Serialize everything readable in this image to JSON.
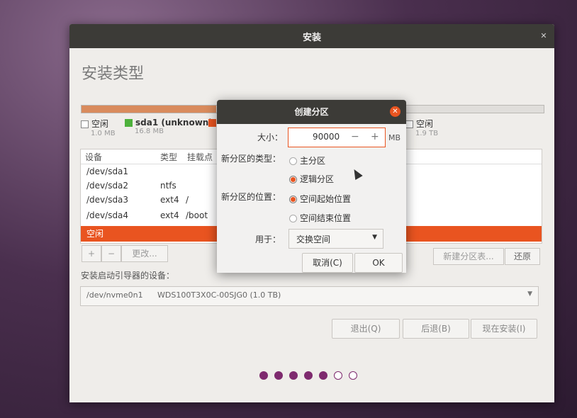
{
  "window": {
    "title": "安装"
  },
  "page": {
    "heading": "安装类型"
  },
  "partition_bar": {
    "legend": [
      {
        "name": "空闲",
        "size": "1.0 MB",
        "color": "#ffffff"
      },
      {
        "name": "sda1 (unknown)",
        "size": "16.8 MB",
        "color": "#4eb13c"
      },
      {
        "name": "",
        "size": "",
        "color": "#e95420"
      },
      {
        "name": "空闲",
        "size": "1.9 TB",
        "color": "#ffffff"
      }
    ]
  },
  "table": {
    "headers": [
      "设备",
      "类型",
      "挂载点"
    ],
    "rows": [
      {
        "device": "/dev/sda1",
        "type": "",
        "mount": ""
      },
      {
        "device": "/dev/sda2",
        "type": "ntfs",
        "mount": ""
      },
      {
        "device": "/dev/sda3",
        "type": "ext4",
        "mount": "/"
      },
      {
        "device": "/dev/sda4",
        "type": "ext4",
        "mount": "/boot"
      },
      {
        "device": "空闲",
        "type": "",
        "mount": ""
      }
    ]
  },
  "toolbar": {
    "add": "+",
    "remove": "−",
    "change": "更改...",
    "new_table": "新建分区表...",
    "revert": "还原"
  },
  "bootloader": {
    "label": "安装启动引导器的设备：",
    "device": "/dev/nvme0n1",
    "model": "WDS100T3X0C-00SJG0 (1.0 TB)"
  },
  "buttons": {
    "quit": "退出(Q)",
    "back": "后退(B)",
    "install": "现在安装(I)"
  },
  "progress": {
    "total_steps": 7,
    "completed_steps": 5
  },
  "dialog": {
    "title": "创建分区",
    "size_label": "大小：",
    "size_value": "90000",
    "minus": "−",
    "plus": "+",
    "unit": "MB",
    "type_label": "新分区的类型：",
    "type_options": [
      "主分区",
      "逻辑分区"
    ],
    "type_selected": "逻辑分区",
    "location_label": "新分区的位置：",
    "location_options": [
      "空间起始位置",
      "空间结束位置"
    ],
    "location_selected": "空间起始位置",
    "use_label": "用于：",
    "use_value": "交换空间",
    "cancel": "取消(C)",
    "ok": "OK"
  },
  "colors": {
    "accent": "#e95420",
    "titlebar": "#3c3b37",
    "progress_dot": "#7e2a6e"
  }
}
